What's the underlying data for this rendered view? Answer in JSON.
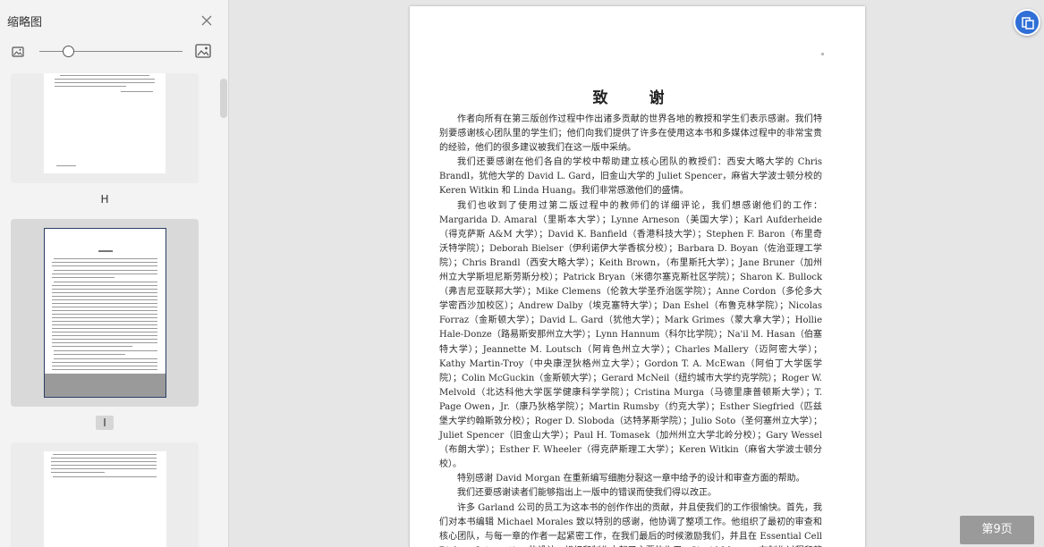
{
  "sidebar": {
    "title": "缩略图",
    "zoom_fraction": 0.2,
    "thumbnails": [
      {
        "label": "H",
        "selected": false
      },
      {
        "label": "I",
        "selected": true
      },
      {
        "label": "",
        "selected": false
      }
    ]
  },
  "document": {
    "heading": "致 谢",
    "paragraphs": [
      "作者向所有在第三版创作过程中作出诸多贡献的世界各地的教授和学生们表示感谢。我们特别要感谢核心团队里的学生们；他们向我们提供了许多在使用这本书和多媒体过程中的非常宝贵的经验，他们的很多建议被我们在这一版中采纳。",
      "我们还要感谢在他们各自的学校中帮助建立核心团队的教授们：西安大略大学的 Chris Brandl，犹他大学的 David L. Gard，旧金山大学的 Juliet Spencer，麻省大学波士顿分校的 Keren Witkin 和 Linda Huang。我们非常感激他们的盛情。",
      "我们也收到了使用过第二版过程中的教师们的详细评论，我们想感谢他们的工作：Margarida D. Amaral（里斯本大学）；Lynne Arneson（美国大学）；Karl Aufderheide（得克萨斯 A&M 大学）；David K. Banfield（香港科技大学）；Stephen F. Baron（布里奇沃特学院）；Deborah Bielser（伊利诺伊大学香槟分校）；Barbara D. Boyan（佐治亚理工学院）；Chris Brandl（西安大略大学）；Keith Brown，（布里斯托大学）；Jane Bruner（加州州立大学斯坦尼斯劳斯分校）；Patrick Bryan（米德尔塞克斯社区学院）；Sharon K. Bullock（弗吉尼亚联邦大学）；Mike Clemens（伦敦大学圣乔治医学院）；Anne Cordon（多伦多大学密西沙加校区）；Andrew Dalby（埃克塞特大学）；Dan Eshel（布鲁克林学院）；Nicolas Forraz（金斯顿大学）；David L. Gard（犹他大学）；Mark Grimes（蒙大拿大学）；Hollie Hale-Donze（路易斯安那州立大学）；Lynn Hannum（科尔比学院）；Na'il M. Hasan（伯塞特大学）；Jeannette M. Loutsch（阿肯色州立大学）；Charles Mallery（迈阿密大学）；Kathy Martin-Troy（中央康涅狄格州立大学）；Gordon T. A. McEwan（阿伯丁大学医学院）；Colin McGuckin（金斯顿大学）；Gerard McNeil（纽约城市大学约克学院）；Roger W. Melvold（北达科他大学医学健康科学学院）；Cristina Murga（马德里康普顿斯大学）；T. Page Owen，Jr.（康乃狄格学院）；Martin Rumsby（约克大学）；Esther Siegfried（匹兹堡大学约翰斯敦分校）；Roger D. Sloboda（达特茅斯学院）；Julio Soto（圣何塞州立大学）；Juliet Spencer（旧金山大学）；Paul H. Tomasek（加州州立大学北岭分校）；Gary Wessel（布朗大学）；Esther F. Wheeler（得克萨斯理工大学）；Keren Witkin（麻省大学波士顿分校）。",
      "特别感谢 David Morgan 在重新编写细胞分裂这一章中给予的设计和审查方面的帮助。",
      "我们还要感谢读者们能够指出上一版中的错误而使我们得以改正。",
      "许多 Garland 公司的员工为这本书的创作作出的贡献，并且使我们的工作很愉快。首先，我们对本书编辑 Michael Morales 致以特别的感谢，他协调了整项工作。他组织了最初的审查和核心团队，与每一章的作者一起紧密工作，在我们最后的时候激励我们，并且在 Essential Cell Biology Interactive 的设计、组织和制作中起了主要的作用。Sigrid Masson 在制作过程和整本书的校对过程中设法使每一章都流畅，并且检查了相应的题库的编写。Kate Ghezzi 和"
    ]
  },
  "page_indicator": "第9页"
}
